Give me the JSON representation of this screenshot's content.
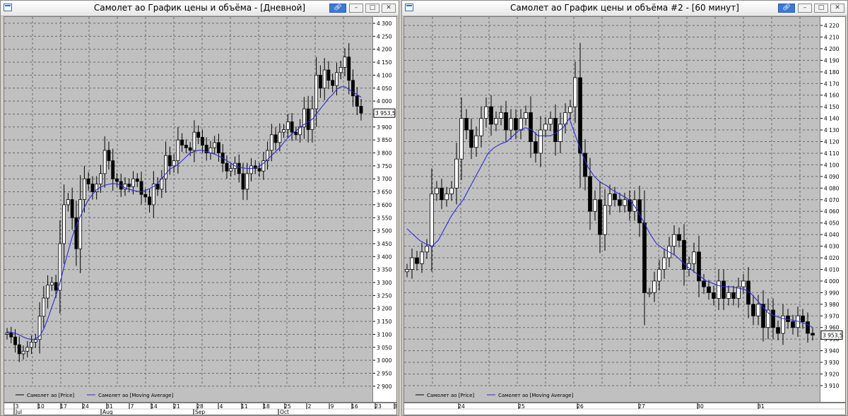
{
  "windows": [
    {
      "title": "Самолет ао График цены и объёма - [Дневной]",
      "last_price_label": "3 953,5",
      "legend": [
        {
          "label": "Самолет ао [Price]",
          "color": "#000000"
        },
        {
          "label": "Самолет ао [Moving Average]",
          "color": "#2b2bd9"
        }
      ],
      "x_ticks": [
        "3",
        "10",
        "17",
        "24",
        "31",
        "7",
        "14",
        "21",
        "28",
        "4",
        "11",
        "18",
        "25",
        "2",
        "9",
        "16",
        "23",
        "30"
      ],
      "x_months": [
        "Jul",
        "Aug",
        "Sep",
        "Oct"
      ],
      "y_ticks": [
        "4 300",
        "4 250",
        "4 200",
        "4 150",
        "4 100",
        "4 050",
        "4 000",
        "3 950",
        "3 900",
        "3 850",
        "3 800",
        "3 750",
        "3 700",
        "3 650",
        "3 600",
        "3 550",
        "3 500",
        "3 450",
        "3 400",
        "3 350",
        "3 300",
        "3 250",
        "3 200",
        "3 150",
        "3 100",
        "3 050",
        "3 000",
        "2 950",
        "2 900"
      ]
    },
    {
      "title": "Самолет ао График цены и объёма #2 - [60 минут]",
      "last_price_label": "3 953,5",
      "legend": [
        {
          "label": "Самолет ао [Price]",
          "color": "#000000"
        },
        {
          "label": "Самолет ао [Moving Average]",
          "color": "#2b2bd9"
        }
      ],
      "x_ticks": [
        "24",
        "25",
        "26",
        "27",
        "30",
        "31"
      ],
      "y_ticks": [
        "4 220",
        "4 210",
        "4 200",
        "4 190",
        "4 180",
        "4 170",
        "4 160",
        "4 150",
        "4 140",
        "4 130",
        "4 120",
        "4 110",
        "4 100",
        "4 090",
        "4 080",
        "4 070",
        "4 060",
        "4 050",
        "4 040",
        "4 030",
        "4 020",
        "4 010",
        "4 000",
        "3 990",
        "3 980",
        "3 970",
        "3 960",
        "3 950",
        "3 940",
        "3 930",
        "3 920",
        "3 910"
      ]
    }
  ],
  "chart_data": [
    {
      "type": "candlestick",
      "title": "Самолет ао График цены и объёма - [Дневной]",
      "ylim": [
        2880,
        4330
      ],
      "grid": true,
      "legend_position": "bottom-left",
      "x_month_labels": [
        "Jul",
        "Aug",
        "Sep",
        "Oct"
      ],
      "x_tick_labels": [
        "3",
        "10",
        "17",
        "24",
        "31",
        "7",
        "14",
        "21",
        "28",
        "4",
        "11",
        "18",
        "25",
        "2",
        "9",
        "16",
        "23",
        "30"
      ],
      "series": [
        {
          "name": "Самолет ао [Price]",
          "close": [
            3105,
            3090,
            3060,
            3025,
            3035,
            3050,
            3070,
            3080,
            3170,
            3240,
            3290,
            3300,
            3270,
            3450,
            3600,
            3620,
            3550,
            3430,
            3620,
            3700,
            3680,
            3650,
            3680,
            3720,
            3810,
            3770,
            3700,
            3690,
            3660,
            3680,
            3670,
            3700,
            3690,
            3640,
            3630,
            3600,
            3680,
            3660,
            3700,
            3790,
            3750,
            3770,
            3850,
            3830,
            3820,
            3810,
            3880,
            3860,
            3830,
            3800,
            3820,
            3840,
            3800,
            3760,
            3730,
            3740,
            3760,
            3720,
            3660,
            3720,
            3750,
            3740,
            3730,
            3770,
            3810,
            3870,
            3840,
            3880,
            3890,
            3920,
            3880,
            3870,
            3900,
            3970,
            3890,
            3970,
            4100,
            4050,
            4120,
            4080,
            4060,
            4110,
            4130,
            4170,
            4080,
            4020,
            3980,
            3953.5
          ]
        },
        {
          "name": "Самолет ао [Moving Average]",
          "values": [
            3110,
            3108,
            3104,
            3098,
            3090,
            3083,
            3081,
            3082,
            3094,
            3120,
            3160,
            3205,
            3250,
            3300,
            3360,
            3420,
            3475,
            3520,
            3555,
            3590,
            3620,
            3640,
            3658,
            3668,
            3675,
            3679,
            3682,
            3680,
            3675,
            3665,
            3660,
            3655,
            3652,
            3650,
            3655,
            3662,
            3670,
            3683,
            3700,
            3720,
            3738,
            3745,
            3755,
            3770,
            3785,
            3800,
            3805,
            3810,
            3810,
            3805,
            3800,
            3795,
            3788,
            3780,
            3770,
            3760,
            3750,
            3745,
            3742,
            3740,
            3740,
            3742,
            3748,
            3760,
            3775,
            3790,
            3805,
            3820,
            3840,
            3858,
            3873,
            3885,
            3898,
            3910,
            3920,
            3930,
            3950,
            3970,
            3990,
            4010,
            4025,
            4045,
            4055,
            4055,
            4045,
            4035,
            4025,
            4015
          ]
        }
      ]
    },
    {
      "type": "candlestick",
      "title": "Самолет ао График цены и объёма #2 - [60 минут]",
      "ylim": [
        3905,
        4225
      ],
      "grid": true,
      "legend_position": "bottom-left",
      "x_tick_labels": [
        "24",
        "25",
        "26",
        "27",
        "30",
        "31"
      ],
      "series": [
        {
          "name": "Самолет ао [Price]",
          "close": [
            4010,
            4020,
            4015,
            4025,
            4030,
            4075,
            4080,
            4070,
            4075,
            4080,
            4105,
            4140,
            4130,
            4115,
            4125,
            4140,
            4150,
            4135,
            4140,
            4145,
            4130,
            4140,
            4130,
            4140,
            4145,
            4120,
            4110,
            4130,
            4135,
            4140,
            4120,
            4135,
            4145,
            4150,
            4175,
            4110,
            4090,
            4060,
            4070,
            4040,
            4065,
            4075,
            4070,
            4065,
            4070,
            4060,
            4070,
            4050,
            3990,
            3990,
            4000,
            4010,
            4020,
            4030,
            4040,
            4035,
            4010,
            4015,
            4025,
            4000,
            3995,
            3990,
            3985,
            4000,
            3985,
            3990,
            3985,
            3995,
            4000,
            3980,
            3970,
            3980,
            3960,
            3975,
            3960,
            3955,
            3970,
            3965,
            3960,
            3970,
            3965,
            3955,
            3953.5
          ]
        },
        {
          "name": "Самолет ао [Moving Average]",
          "values": [
            4045,
            4040,
            4035,
            4032,
            4030,
            4035,
            4045,
            4055,
            4063,
            4070,
            4080,
            4090,
            4100,
            4110,
            4115,
            4118,
            4120,
            4125,
            4130,
            4132,
            4130,
            4125,
            4125,
            4125,
            4128,
            4132,
            4140,
            4125,
            4110,
            4098,
            4090,
            4085,
            4082,
            4078,
            4075,
            4072,
            4068,
            4060,
            4050,
            4040,
            4032,
            4028,
            4025,
            4022,
            4017,
            4012,
            4008,
            4004,
            4000,
            3998,
            3996,
            3995,
            3995,
            3994,
            3993,
            3990,
            3984,
            3978,
            3972,
            3970,
            3968,
            3967,
            3966,
            3965,
            3963,
            3960
          ]
        }
      ]
    }
  ]
}
